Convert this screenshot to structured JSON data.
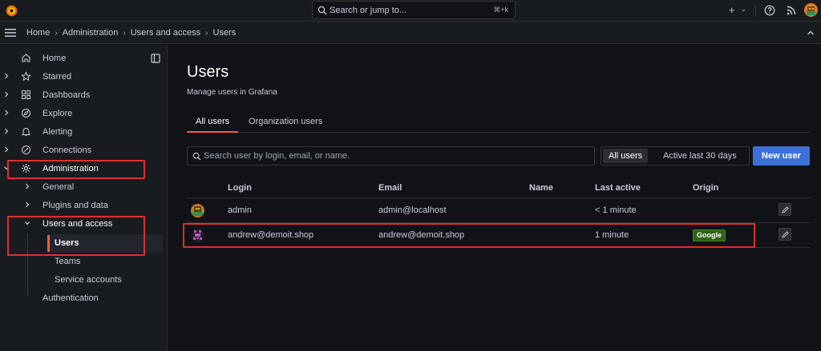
{
  "topbar": {
    "search_placeholder": "Search or jump to...",
    "search_shortcut": "⌘+k",
    "new_label": "+",
    "new_caret": "⌄"
  },
  "breadcrumb": {
    "items": [
      "Home",
      "Administration",
      "Users and access",
      "Users"
    ],
    "separator": "›"
  },
  "sidebar": {
    "items": [
      {
        "label": "Home",
        "icon": "home-icon"
      },
      {
        "label": "Starred",
        "icon": "star-icon"
      },
      {
        "label": "Dashboards",
        "icon": "dashboards-icon"
      },
      {
        "label": "Explore",
        "icon": "compass-icon"
      },
      {
        "label": "Alerting",
        "icon": "bell-icon"
      },
      {
        "label": "Connections",
        "icon": "link-icon"
      },
      {
        "label": "Administration",
        "icon": "gear-icon"
      }
    ],
    "admin_children": {
      "general": "General",
      "plugins": "Plugins and data",
      "users_and_access": "Users and access",
      "users": "Users",
      "teams": "Teams",
      "service_accounts": "Service accounts",
      "authentication": "Authentication"
    }
  },
  "main": {
    "title": "Users",
    "subtitle": "Manage users in Grafana",
    "tabs": [
      {
        "label": "All users",
        "active": true
      },
      {
        "label": "Organization users",
        "active": false
      }
    ],
    "search_placeholder": "Search user by login, email, or name.",
    "filter": {
      "options": [
        "All users",
        "Active last 30 days"
      ],
      "selected": "All users"
    },
    "new_user_label": "New user"
  },
  "table": {
    "columns": [
      "Login",
      "Email",
      "Name",
      "Last active",
      "Origin"
    ],
    "rows": [
      {
        "login": "admin",
        "email": "admin@localhost",
        "name": "",
        "last_active": "< 1 minute",
        "origin": ""
      },
      {
        "login": "andrew@demoit.shop",
        "email": "andrew@demoit.shop",
        "name": "",
        "last_active": "1 minute",
        "origin": "Google"
      }
    ]
  },
  "colors": {
    "accent": "#f55f3e",
    "primary": "#3d71d9",
    "highlight": "#e02f2a",
    "badge_green": "#2e6315"
  }
}
